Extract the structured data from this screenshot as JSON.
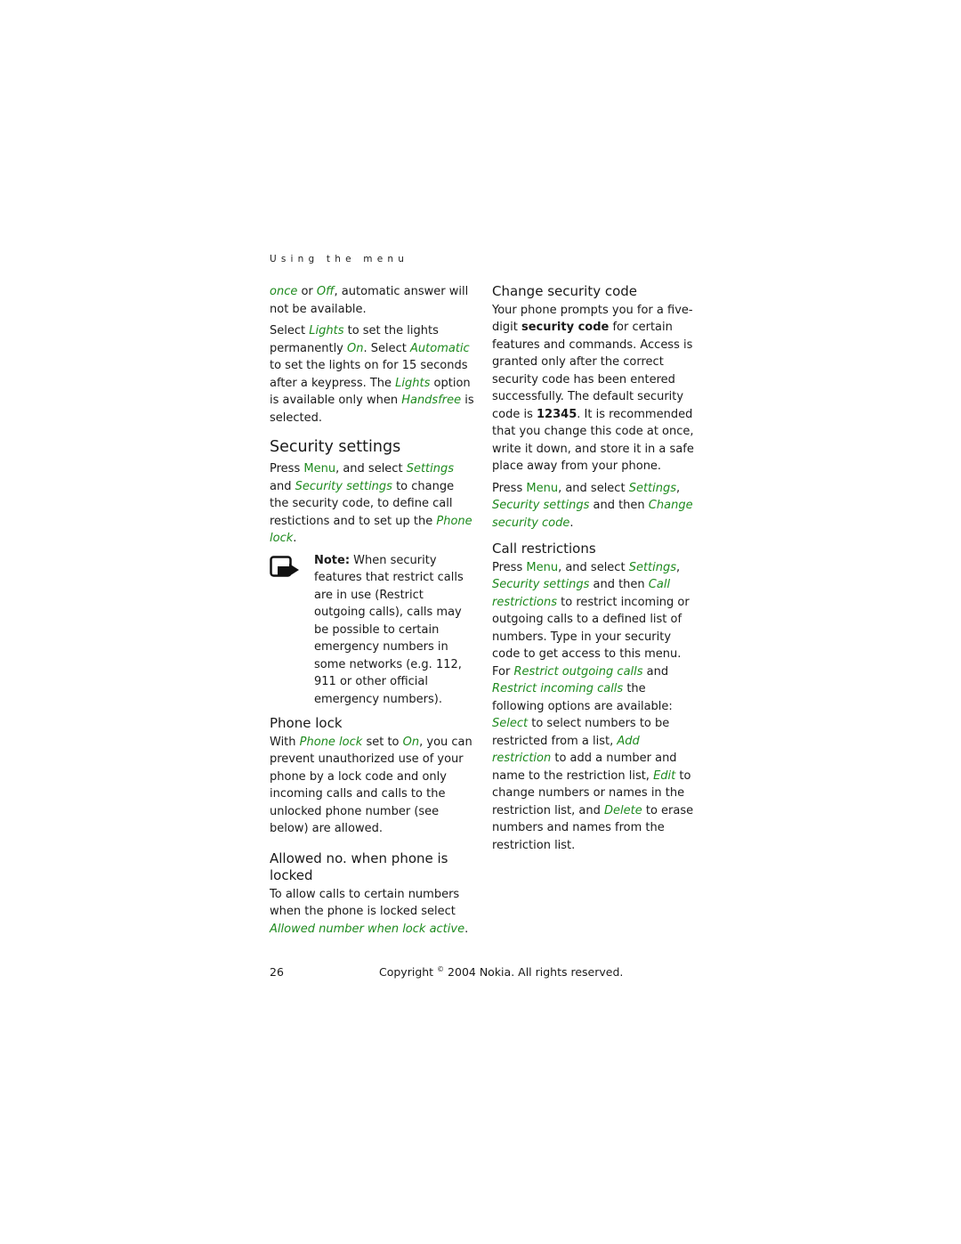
{
  "header": {
    "running_title": "Using the menu"
  },
  "left_column": {
    "p1": {
      "t1": "once",
      "t2": " or ",
      "t3": "Off",
      "t4": ", automatic answer will not be available."
    },
    "p2": {
      "t1": "Select ",
      "t2": "Lights",
      "t3": " to set the lights permanently ",
      "t4": "On",
      "t5": ". Select ",
      "t6": "Automatic",
      "t7": " to set the lights on for 15 seconds after a keypress. The ",
      "t8": "Lights",
      "t9": " option is available only when ",
      "t10": "Handsfree",
      "t11": " is selected."
    },
    "security_settings": {
      "heading": "Security settings",
      "t1": "Press ",
      "t2": "Menu",
      "t3": ", and select ",
      "t4": "Settings",
      "t5": " and ",
      "t6": "Security settings",
      "t7": " to change the security code, to define call restictions and to set up the ",
      "t8": "Phone lock",
      "t9": "."
    },
    "note": {
      "icon": "note-hand-icon",
      "label": "Note:",
      "text": " When security features that restrict calls are in use (Restrict outgoing calls), calls may be possible to certain emergency numbers in some networks (e.g. 112, 911 or other official emergency numbers)."
    },
    "phone_lock": {
      "heading": "Phone lock",
      "t1": "With ",
      "t2": "Phone lock",
      "t3": " set to ",
      "t4": "On",
      "t5": ", you can prevent unauthorized use of your phone by a lock code and only incoming calls and calls to the unlocked phone number (see below) are allowed."
    },
    "allowed_no": {
      "heading": "Allowed no. when phone is locked",
      "t1": "To allow calls to certain numbers when the phone is locked select ",
      "t2": "Allowed number when lock active",
      "t3": "."
    }
  },
  "right_column": {
    "change_code": {
      "heading": "Change security code",
      "t1": "Your phone prompts you for a five-digit ",
      "t2": "security code",
      "t3": " for certain features and commands. Access is granted only after the correct security code has been entered successfully. The default security code is ",
      "t4": "12345",
      "t5": ". It is recommended that you change this code at once, write it down, and store it in a safe place away from your phone."
    },
    "change_code_nav": {
      "t1": "Press ",
      "t2": "Menu",
      "t3": ", and select ",
      "t4": "Settings",
      "t5": ", ",
      "t6": "Security settings",
      "t7": " and then ",
      "t8": "Change security code",
      "t9": "."
    },
    "call_restrictions": {
      "heading": "Call restrictions",
      "t1": "Press ",
      "t2": "Menu",
      "t3": ", and select ",
      "t4": "Settings",
      "t5": ", ",
      "t6": "Security settings",
      "t7": " and then ",
      "t8": "Call restrictions",
      "t9": " to restrict incoming or outgoing calls to a defined list of numbers. Type in your security code to get access to this menu. For ",
      "t10": "Restrict outgoing calls",
      "t11": " and ",
      "t12": "Restrict incoming calls",
      "t13": " the following options are available: ",
      "t14": "Select",
      "t15": " to select numbers to be restricted from a list, ",
      "t16": "Add restriction",
      "t17": " to add a number and name to the restriction list, ",
      "t18": "Edit",
      "t19": " to change numbers or names in the restriction list, and ",
      "t20": "Delete",
      "t21": " to erase numbers and names from the restriction list."
    }
  },
  "footer": {
    "page_number": "26",
    "copyright_pre": "Copyright ",
    "copyright_symbol": "©",
    "copyright_post": " 2004 Nokia. All rights reserved."
  },
  "colors": {
    "accent_green": "#1e8a1e",
    "text": "#1a1a1a"
  }
}
